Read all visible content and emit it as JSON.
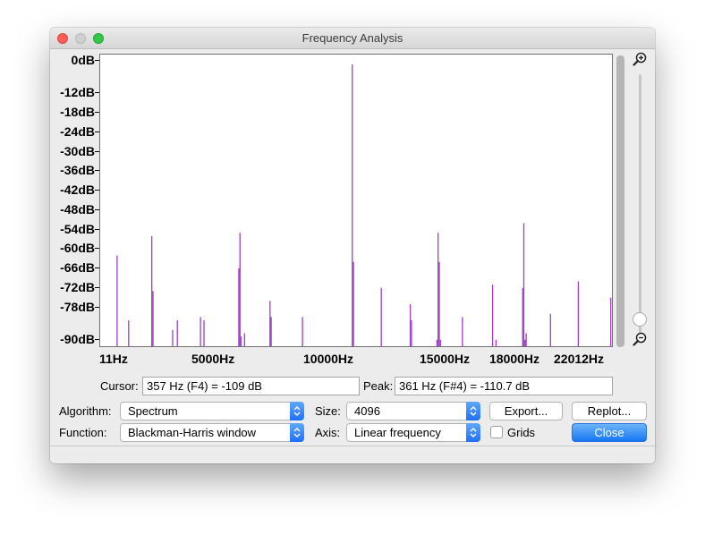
{
  "window": {
    "title": "Frequency Analysis"
  },
  "plot": {
    "y_labels": [
      "0dB",
      "-12dB",
      "-18dB",
      "-24dB",
      "-30dB",
      "-36dB",
      "-42dB",
      "-48dB",
      "-54dB",
      "-60dB",
      "-66dB",
      "-72dB",
      "-78dB",
      "-90dB"
    ],
    "x_labels": [
      "11Hz",
      "5000Hz",
      "10000Hz",
      "15000Hz",
      "18000Hz",
      "22012Hz"
    ],
    "spectrum_color": "#9a3fc6"
  },
  "chart_data": {
    "type": "bar",
    "x_unit": "Hz",
    "y_unit": "dB",
    "xlim": [
      11,
      22012
    ],
    "ylim": [
      -90,
      0
    ],
    "x": [
      700,
      1200,
      2200,
      2250,
      3100,
      3300,
      4300,
      4450,
      5950,
      6000,
      6050,
      6200,
      7300,
      7350,
      8700,
      10850,
      10900,
      12100,
      13350,
      13400,
      14500,
      14550,
      14600,
      14650,
      15600,
      16900,
      17050,
      18200,
      18250,
      18300,
      18350,
      19400,
      20600,
      22000
    ],
    "y": [
      -62,
      -82,
      -56,
      -73,
      -85,
      -82,
      -81,
      -82,
      -66,
      -55,
      -87,
      -86,
      -76,
      -81,
      -81,
      -3,
      -64,
      -72,
      -77,
      -82,
      -88,
      -55,
      -64,
      -88,
      -81,
      -71,
      -88,
      -72,
      -52,
      -88,
      -86,
      -80,
      -70,
      -75
    ]
  },
  "cursor": {
    "label": "Cursor:",
    "value": "357 Hz (F4) = -109 dB"
  },
  "peak": {
    "label": "Peak:",
    "value": "361 Hz (F#4) = -110.7 dB"
  },
  "controls": {
    "algorithm_label": "Algorithm:",
    "algorithm_value": "Spectrum",
    "function_label": "Function:",
    "function_value": "Blackman-Harris window",
    "size_label": "Size:",
    "size_value": "4096",
    "axis_label": "Axis:",
    "axis_value": "Linear frequency",
    "grids_label": "Grids",
    "grids_checked": false,
    "export_label": "Export...",
    "replot_label": "Replot...",
    "close_label": "Close"
  }
}
